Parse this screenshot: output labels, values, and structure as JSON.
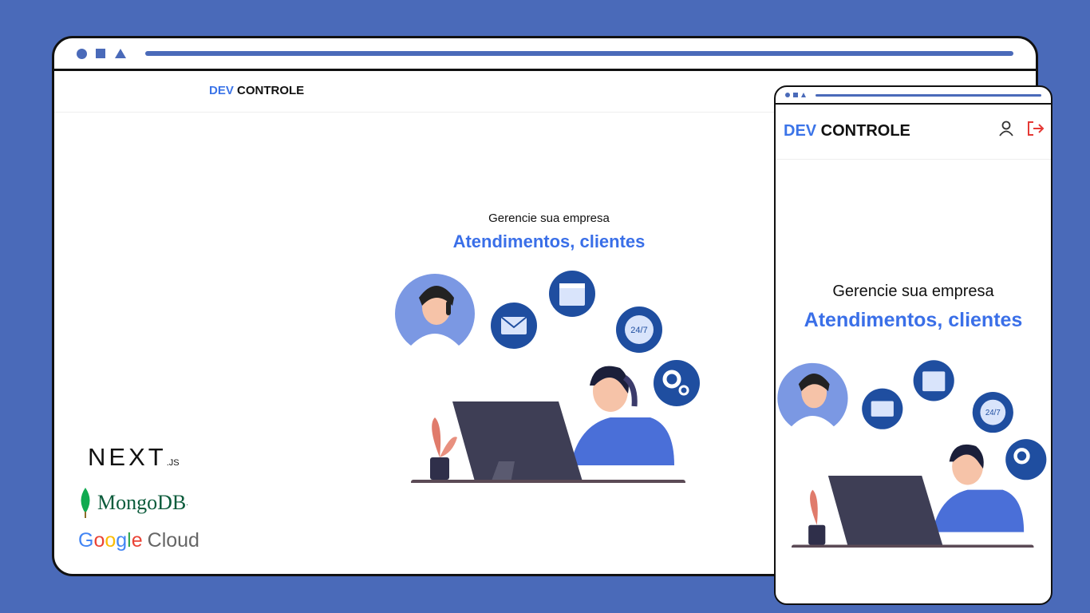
{
  "desktop": {
    "brand_prefix": "DEV",
    "brand_suffix": " CONTROLE",
    "subtitle": "Gerencie sua empresa",
    "headline": "Atendimentos, clientes"
  },
  "mobile": {
    "brand_prefix": "DEV",
    "brand_suffix": " CONTROLE",
    "subtitle": "Gerencie sua empresa",
    "headline": "Atendimentos, clientes",
    "header_icons": [
      "user-icon",
      "logout-icon"
    ]
  },
  "illustration": {
    "clock_label": "24/7"
  },
  "tech_logos": {
    "next_main": "NEXT",
    "next_suffix": ".JS",
    "mongo": "MongoDB",
    "mongo_mark": ".",
    "google": [
      "G",
      "o",
      "o",
      "g",
      "l",
      "e"
    ],
    "cloud": "Cloud"
  },
  "colors": {
    "background": "#4a6ab9",
    "accent": "#3a6fe8",
    "logout": "#e53935",
    "mongo_green": "#0b5b3b"
  }
}
